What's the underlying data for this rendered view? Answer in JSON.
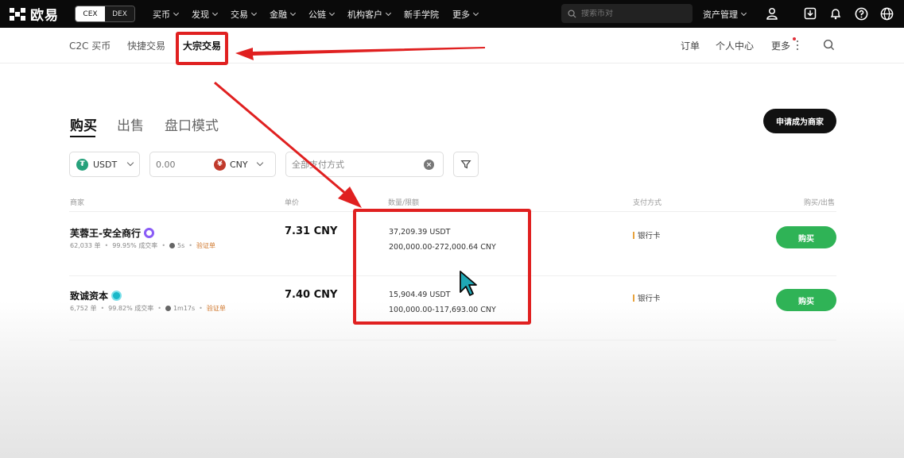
{
  "topnav": {
    "logo_text": "欧易",
    "cex_label": "CEX",
    "dex_label": "DEX",
    "items": [
      "买币",
      "发现",
      "交易",
      "金融",
      "公链",
      "机构客户",
      "新手学院",
      "更多"
    ],
    "search_placeholder": "搜索币对",
    "asset_label": "资产管理"
  },
  "subnav": {
    "items": [
      "C2C 买币",
      "快捷交易",
      "大宗交易"
    ],
    "active": "大宗交易",
    "right_items": [
      "订单",
      "个人中心",
      "更多"
    ]
  },
  "tabs": [
    "购买",
    "出售",
    "盘口模式"
  ],
  "merchant_button": "申请成为商家",
  "filters": {
    "coin": "USDT",
    "amount_placeholder": "0.00",
    "currency": "CNY",
    "payment_placeholder": "全部支付方式"
  },
  "table": {
    "headers": [
      "商家",
      "单价",
      "数量/限额",
      "支付方式",
      "购买/出售"
    ],
    "rows": [
      {
        "name": "芙蓉王-安全商行",
        "orders": "62,033 单",
        "rate": "99.95% 成交率",
        "time": "5s",
        "verify": "验证单",
        "price": "7.31 CNY",
        "quantity": "37,209.39 USDT",
        "limit": "200,000.00-272,000.64 CNY",
        "payment": "银行卡",
        "action": "购买"
      },
      {
        "name": "致诚资本",
        "orders": "6,752 单",
        "rate": "99.82% 成交率",
        "time": "1m17s",
        "verify": "验证单",
        "price": "7.40 CNY",
        "quantity": "15,904.49 USDT",
        "limit": "100,000.00-117,693.00 CNY",
        "payment": "银行卡",
        "action": "购买"
      }
    ]
  },
  "colors": {
    "highlight": "#e02020",
    "buy_green": "#2fb356",
    "usdt_green": "#26a17b",
    "cny_red": "#c0392b"
  }
}
